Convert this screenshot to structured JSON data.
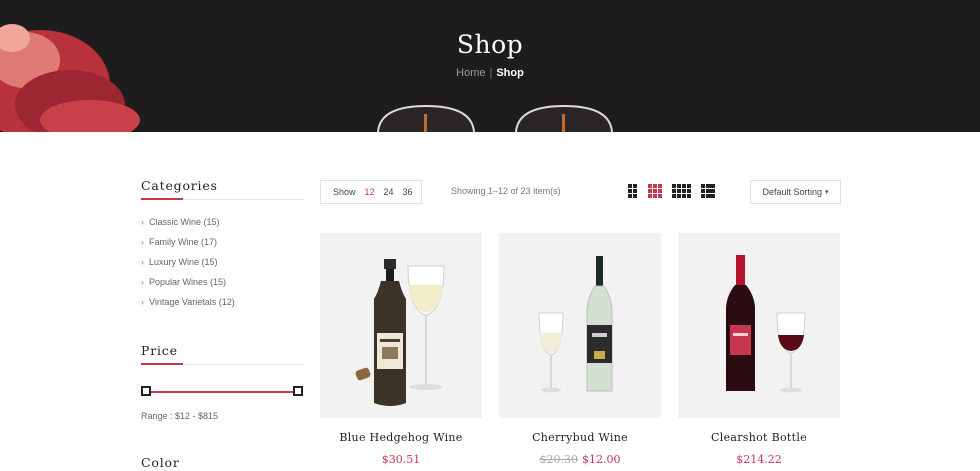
{
  "hero": {
    "title": "Shop",
    "breadcrumb": {
      "home": "Home",
      "separator": "|",
      "current": "Shop"
    }
  },
  "sidebar": {
    "categories_title": "Categories",
    "categories": [
      {
        "label": "Classic Wine (15)"
      },
      {
        "label": "Family Wine (17)"
      },
      {
        "label": "Luxury Wine (15)"
      },
      {
        "label": "Popular Wines (15)"
      },
      {
        "label": "Vintage Varietals (12)"
      }
    ],
    "price_title": "Price",
    "price_range_text": "Range : $12 - $815",
    "color_title": "Color"
  },
  "toolbar": {
    "show_label": "Show",
    "show_options": [
      "12",
      "24",
      "36"
    ],
    "show_selected": "12",
    "showing_text": "Showing 1–12 of 23 item(s)",
    "sort_label": "Default Sorting",
    "active_view": "grid-3"
  },
  "products": [
    {
      "name": "Blue Hedgehog Wine",
      "price": "$30.51",
      "old_price": ""
    },
    {
      "name": "Cherrybud Wine",
      "price": "$12.00",
      "old_price": "$20.30"
    },
    {
      "name": "Clearshot Bottle",
      "price": "$214.22",
      "old_price": ""
    }
  ],
  "colors": {
    "accent": "#c8354f",
    "hero_bg": "#1e1c1d",
    "card_bg": "#f2f2f2"
  }
}
